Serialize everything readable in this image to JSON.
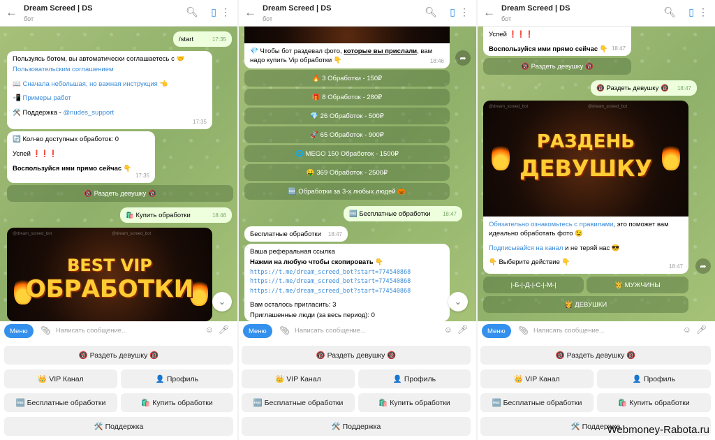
{
  "header": {
    "title": "Dream Screed | DS",
    "subtitle": "бот"
  },
  "input": {
    "menu_label": "Меню",
    "placeholder": "Написать сообщение..."
  },
  "keyboard": {
    "row1": "🔞 Раздеть девушку 🔞",
    "vip": "👑 VIP Канал",
    "profile": "👤 Профиль",
    "free": "🆓 Бесплатные обработки",
    "buy": "🛍️ Купить обработки",
    "support": "🛠️ Поддержка"
  },
  "panel1": {
    "start": {
      "text": "/start",
      "time": "17:35"
    },
    "welcome": {
      "line1": "Пользуясь ботом, вы автоматически соглашаетесь с 🤝",
      "link1": "Пользовательским соглашением",
      "line2_icon": "📖",
      "line2_link": "Сначала небольшая, но важная инструкция 👈",
      "line3_icon": "📲",
      "line3_link": "Примеры работ",
      "line4": "🛠️ Поддержка - ",
      "line4_link": "@nudes_support",
      "time": "17:35"
    },
    "count": {
      "line1": "🔄 Кол-во доступных обработок: 0",
      "line2": "Успей ❗❗❗",
      "line3": "Воспользуйся ими прямо сейчас 👇",
      "time": "17:35"
    },
    "undress_btn": "🔞 Раздеть девушку 🔞",
    "buy": {
      "text": "🛍️ Купить обработки",
      "time": "18:46"
    },
    "image": {
      "line1": "BEST VIP",
      "line2": "ОБРАБОТКИ",
      "wm": "@dream_screed_bot"
    }
  },
  "panel2": {
    "intro": {
      "text1": "💎 Чтобы бот раздевал фото, ",
      "link": "которые вы прислали",
      "text2": ", вам надо купить Vip обработки 👇",
      "time": "18:46"
    },
    "options": [
      "🔥 3 Обработки - 150₽",
      "🎁 8 Обработок - 280₽",
      "💎 26 Обработок - 500₽",
      "🚀 65 Обработок - 900₽",
      "🌐 MEGO 150 Обработок - 1500₽",
      "🤑 369 Обработок - 2500₽",
      "🆓 Обработки за 3-х любых людей 🎃"
    ],
    "free": {
      "text": "🆓 Бесплатные обработки",
      "time": "18:47"
    },
    "free_in": {
      "text": "Бесплатные обработки",
      "time": "18:47"
    },
    "ref": {
      "line1": "Ваша реферальная ссылка",
      "line2": "Нажми на любую чтобы скопировать 👇",
      "links": [
        "https://t.me/dream_screed_bot?start=774540868",
        "https://t.me/dream_screed_bot?start=774540868",
        "https://t.me/dream_screed_bot?start=774540868"
      ],
      "line3": "Вам осталось пригласить: 3",
      "line4": "Приглашенные люди (за весь период): 0"
    }
  },
  "panel3": {
    "top": {
      "line1": "Успей ❗❗❗",
      "line2": "Воспользуйся ими прямо сейчас 👇",
      "time": "18:47"
    },
    "undress_btn": "🔞 Раздеть девушку 🔞",
    "undress_out": {
      "text": "🔞 Раздеть девушку 🔞",
      "time": "18:47"
    },
    "image": {
      "line1": "РАЗДЕНЬ",
      "line2": "ДЕВУШКУ",
      "wm": "@dream_screed_bot"
    },
    "caption": {
      "link1": "Обязательно ознакомьтесь с правилами",
      "text1": ", это поможет вам идеально обработать фото 😉",
      "link2": "Подписывайся на канал",
      "text2": " и не теряй нас 😎",
      "line3": "👇 Выберите действие 👇",
      "time": "18:47"
    },
    "choice1": "|-Б-|-Д-|-С-|-М-|",
    "choice2": "🤴 МУЖЧИНЫ",
    "choice3": "👸 ДЕВУШКИ"
  },
  "watermark": "Webmoney-Rabota.ru"
}
